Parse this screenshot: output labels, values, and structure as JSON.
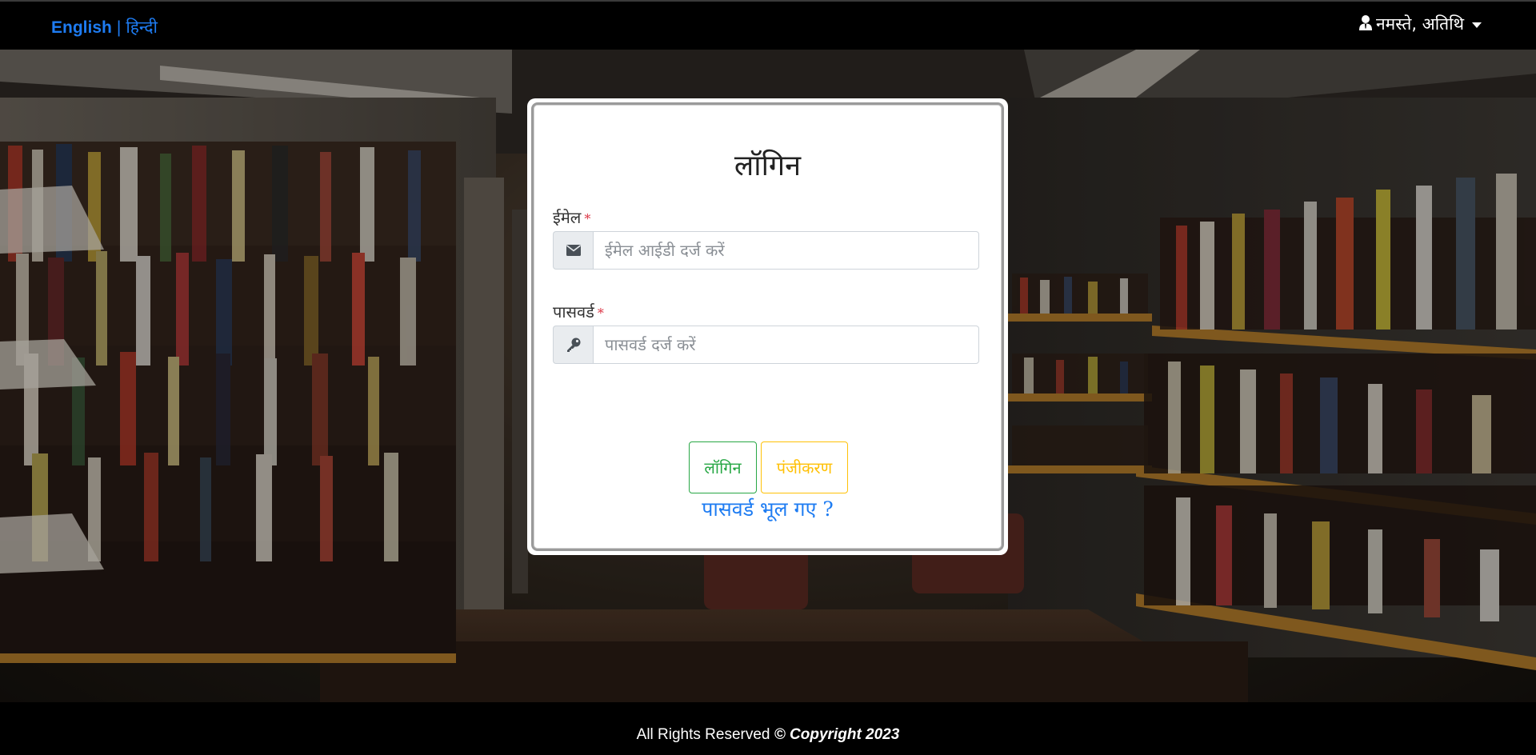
{
  "navbar": {
    "lang_english": "English",
    "lang_separator": "|",
    "lang_hindi": "हिन्दी",
    "user_greeting": "नमस्ते, अतिथि",
    "user_icon": "user-icon"
  },
  "login": {
    "title": "लॉगिन",
    "email_label": "ईमेल",
    "email_required": "*",
    "email_placeholder": "ईमेल आईडी दर्ज करें",
    "email_icon": "envelope-icon",
    "password_label": "पासवर्ड",
    "password_required": "*",
    "password_placeholder": "पासवर्ड दर्ज करें",
    "password_icon": "key-icon",
    "login_button": "लॉगिन",
    "register_button": "पंजीकरण",
    "forgot_link": "पासवर्ड भूल गए ?"
  },
  "footer": {
    "rights": "All Rights Reserved",
    "copyright": "© Copyright 2023"
  },
  "colors": {
    "link": "#1e7cf2",
    "login_btn": "#28a745",
    "register_btn": "#ffc107",
    "required": "#dc3545"
  }
}
